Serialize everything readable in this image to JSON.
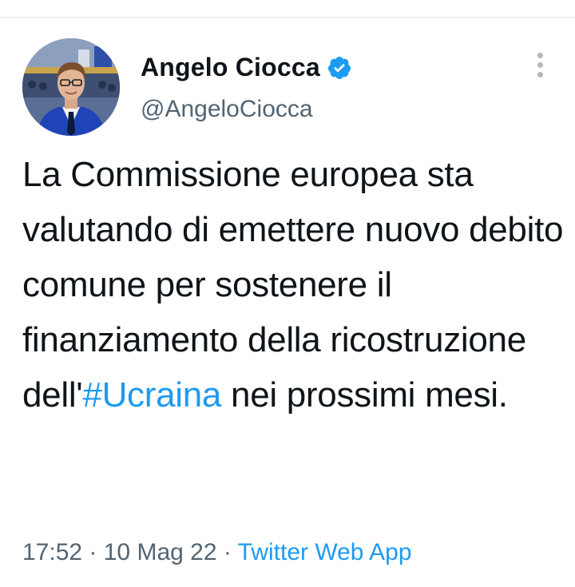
{
  "author": {
    "display_name": "Angelo Ciocca",
    "handle": "@AngeloCiocca",
    "verified": true,
    "verified_icon": "verified-badge-icon"
  },
  "tweet": {
    "text_before": "La Commissione europea sta valutando di emettere nuovo debito comune per sostenere il finanziamento della ricostruzione dell'",
    "hashtag": "#Ucraina",
    "text_after": " nei prossimi mesi."
  },
  "meta": {
    "time": "17:52",
    "separator": " · ",
    "date": "10 Mag 22",
    "separator2": " · ",
    "source": "Twitter Web App"
  },
  "menu": {
    "icon": "more-vertical-icon"
  },
  "colors": {
    "accent": "#1d9bf0",
    "text": "#0f1419",
    "secondary": "#536471"
  }
}
